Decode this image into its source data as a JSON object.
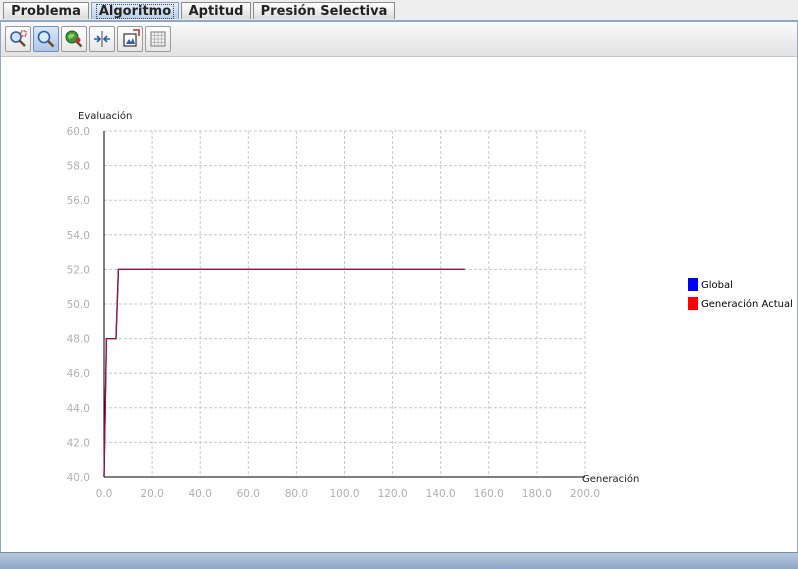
{
  "tabs": [
    {
      "label": "Problema",
      "active": false
    },
    {
      "label": "Algoritmo",
      "active": true
    },
    {
      "label": "Aptitud",
      "active": false
    },
    {
      "label": "Presión Selectiva",
      "active": false
    }
  ],
  "toolbar": {
    "buttons": [
      {
        "icon": "zoom-box-icon",
        "active": false
      },
      {
        "icon": "magnifier-icon",
        "active": true
      },
      {
        "icon": "pan-icon",
        "active": false
      },
      {
        "icon": "fit-icon",
        "active": false
      },
      {
        "icon": "save-image-icon",
        "active": false
      },
      {
        "icon": "grid-icon",
        "active": false
      }
    ]
  },
  "colors": {
    "global": "#0000ff",
    "current": "#ff0000",
    "line": "#a01030",
    "grid": "#c8c8c8",
    "tick_label": "#b0b0b0"
  },
  "chart_data": {
    "type": "line",
    "title": "",
    "xlabel": "Generación",
    "ylabel": "Evaluación",
    "xlim": [
      0,
      200
    ],
    "ylim": [
      40,
      60
    ],
    "xticks": [
      "0.0",
      "20.0",
      "40.0",
      "60.0",
      "80.0",
      "100.0",
      "120.0",
      "140.0",
      "160.0",
      "180.0",
      "200.0"
    ],
    "yticks": [
      "40.0",
      "42.0",
      "44.0",
      "46.0",
      "48.0",
      "50.0",
      "52.0",
      "54.0",
      "56.0",
      "58.0",
      "60.0"
    ],
    "grid": true,
    "legend_position": "right",
    "series": [
      {
        "name": "Global",
        "x": [
          0,
          1,
          5,
          6,
          150
        ],
        "y": [
          40,
          48,
          48,
          52,
          52
        ]
      },
      {
        "name": "Generación Actual",
        "x": [
          0,
          1,
          5,
          6,
          150
        ],
        "y": [
          40,
          48,
          48,
          52,
          52
        ]
      }
    ]
  }
}
